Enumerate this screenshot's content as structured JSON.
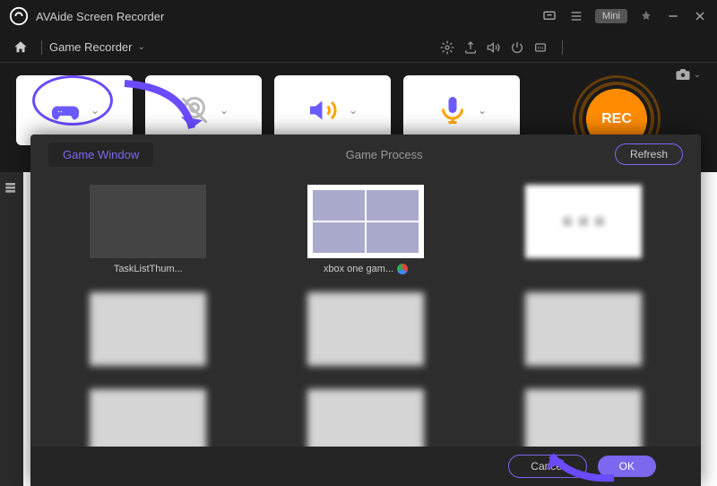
{
  "title": "AVAide Screen Recorder",
  "mini_label": "Mini",
  "mode": "Game Recorder",
  "rec_label": "REC",
  "popup": {
    "tab_window": "Game Window",
    "tab_process": "Game Process",
    "refresh": "Refresh",
    "cancel": "Cancel",
    "ok": "OK",
    "items": [
      {
        "label": "TaskListThum..."
      },
      {
        "label": "xbox one gam..."
      },
      {
        "label": ""
      },
      {
        "label": ""
      },
      {
        "label": ""
      },
      {
        "label": ""
      },
      {
        "label": ""
      },
      {
        "label": ""
      },
      {
        "label": ""
      }
    ]
  }
}
